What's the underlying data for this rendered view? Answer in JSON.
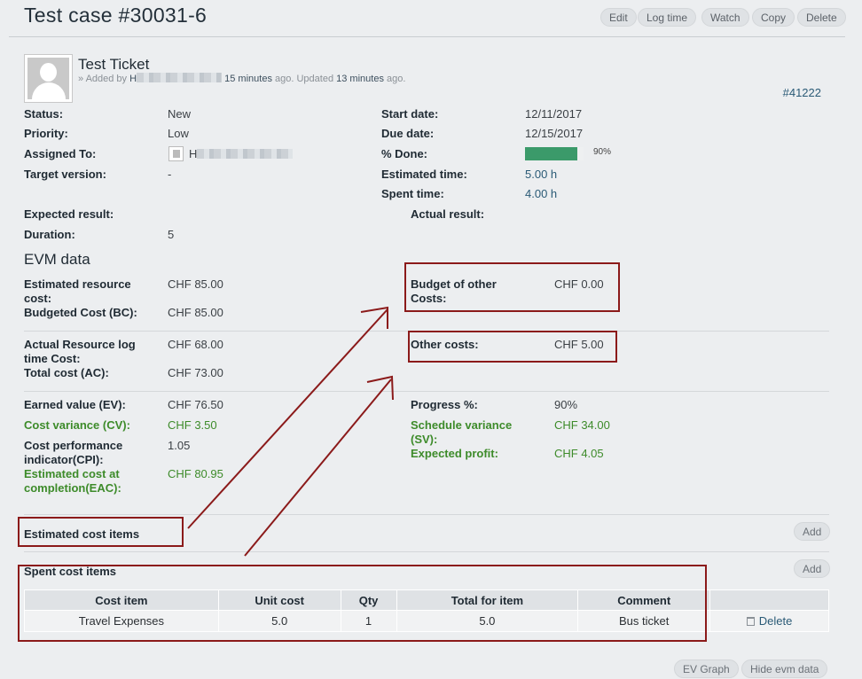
{
  "header": {
    "title": "Test case #30031-6",
    "buttons": {
      "edit": "Edit",
      "log_time": "Log time",
      "watch": "Watch",
      "copy": "Copy",
      "delete": "Delete"
    }
  },
  "issue": {
    "subject": "Test Ticket",
    "author_prefix": "» Added by",
    "author_initial": "H",
    "added_ago": "15 minutes",
    "ago_text": "ago. Updated",
    "updated_ago": "13 minutes",
    "ago_end": "ago.",
    "id": "#41222"
  },
  "attributes": {
    "status": {
      "label": "Status:",
      "value": "New"
    },
    "priority": {
      "label": "Priority:",
      "value": "Low"
    },
    "assigned_to": {
      "label": "Assigned To:",
      "value": "H"
    },
    "target_version": {
      "label": "Target version:",
      "value": "-"
    },
    "start_date": {
      "label": "Start date:",
      "value": "12/11/2017"
    },
    "due_date": {
      "label": "Due date:",
      "value": "12/15/2017"
    },
    "done": {
      "label": "% Done:",
      "value": "90%",
      "percent": 90
    },
    "estimated_time": {
      "label": "Estimated time:",
      "value": "5.00 h"
    },
    "spent_time": {
      "label": "Spent time:",
      "value": "4.00 h"
    },
    "expected_result": {
      "label": "Expected result:"
    },
    "actual_result": {
      "label": "Actual result:"
    },
    "duration": {
      "label": "Duration:",
      "value": "5"
    }
  },
  "evm": {
    "title": "EVM data",
    "estimated_resource_cost": {
      "label_1": "Estimated resource",
      "label_2": "cost:",
      "value": "CHF 85.00"
    },
    "budget_other_costs": {
      "label_1": "Budget of other",
      "label_2": "Costs:",
      "value": "CHF 0.00"
    },
    "budgeted_cost": {
      "label": "Budgeted Cost (BC):",
      "value": "CHF 85.00"
    },
    "actual_resource_log": {
      "label_1": "Actual Resource log",
      "label_2": "time Cost:",
      "value": "CHF 68.00"
    },
    "other_costs": {
      "label": "Other costs:",
      "value": "CHF 5.00"
    },
    "total_cost": {
      "label": "Total cost (AC):",
      "value": "CHF 73.00"
    },
    "earned_value": {
      "label": "Earned value (EV):",
      "value": "CHF 76.50"
    },
    "progress": {
      "label": "Progress %:",
      "value": "90%"
    },
    "cost_variance": {
      "label": "Cost variance (CV):",
      "value": "CHF 3.50"
    },
    "schedule_variance": {
      "label_1": "Schedule variance",
      "label_2": "(SV):",
      "value": "CHF 34.00"
    },
    "cpi": {
      "label_1": "Cost performance",
      "label_2": "indicator(CPI):",
      "value": "1.05"
    },
    "expected_profit": {
      "label": "Expected profit:",
      "value": "CHF 4.05"
    },
    "eac": {
      "label_1": "Estimated cost at",
      "label_2": "completion(EAC):",
      "value": "CHF 80.95"
    }
  },
  "estimated_items": {
    "title": "Estimated cost items",
    "add": "Add"
  },
  "spent_items": {
    "title": "Spent cost items",
    "add": "Add",
    "columns": [
      "Cost item",
      "Unit cost",
      "Qty",
      "Total for item",
      "Comment"
    ],
    "rows": [
      {
        "item": "Travel Expenses",
        "unit_cost": "5.0",
        "qty": "1",
        "total": "5.0",
        "comment": "Bus ticket",
        "action": "Delete"
      }
    ]
  },
  "footer": {
    "ev_graph": "EV Graph",
    "hide_evm": "Hide evm data"
  },
  "colors": {
    "annotation": "#8b1a1a",
    "progress": "#3b9a6a",
    "positive": "#3d8b2a"
  }
}
